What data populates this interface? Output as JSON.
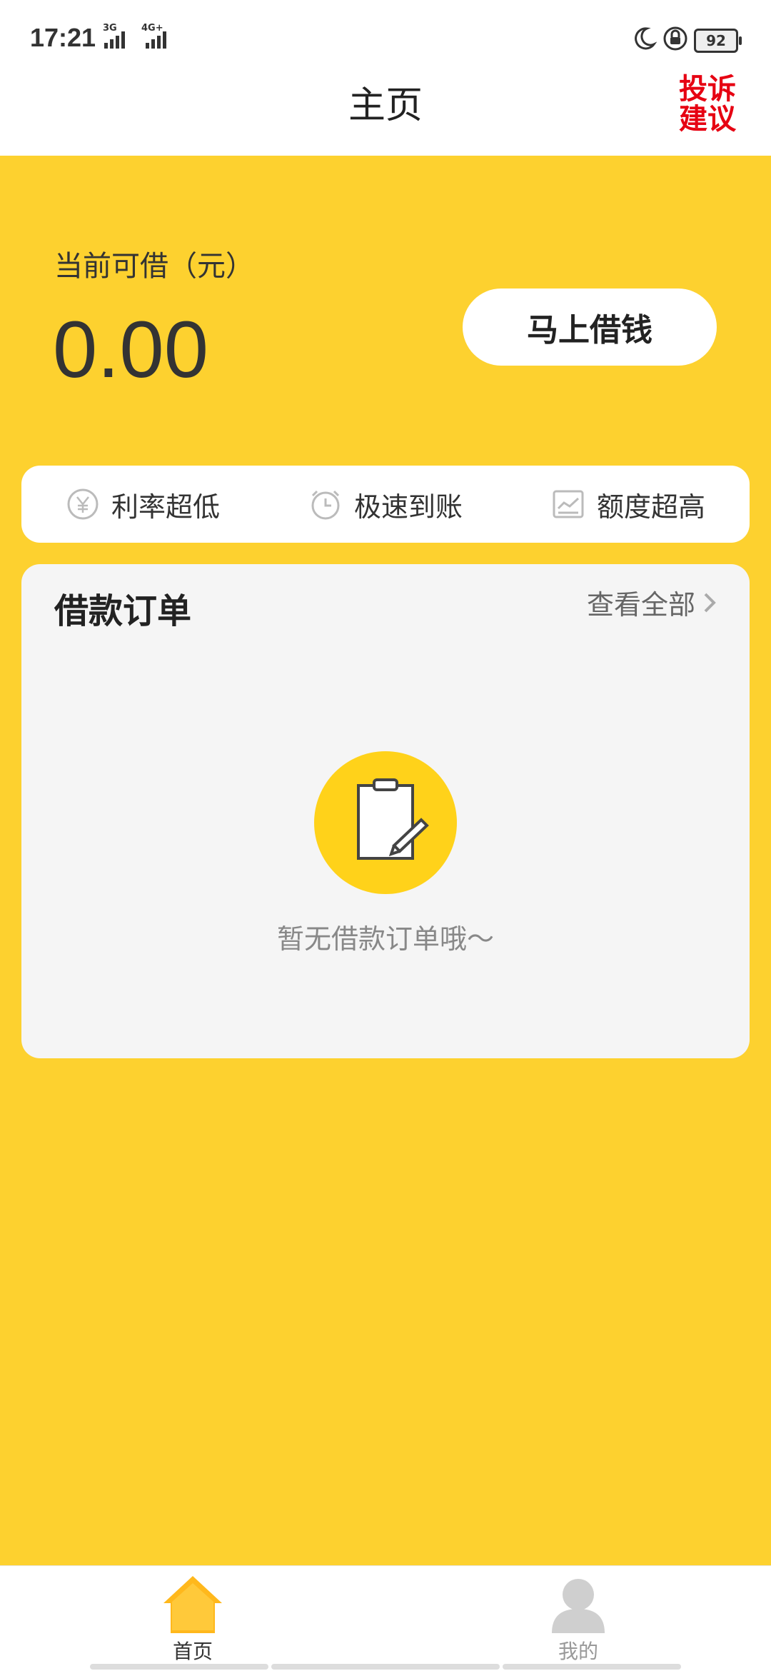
{
  "status_bar": {
    "time": "17:21",
    "signal1_label": "3G",
    "signal2_label": "4G+",
    "battery": "92"
  },
  "header": {
    "title": "主页",
    "complaint_line1": "投诉",
    "complaint_line2": "建议"
  },
  "loan": {
    "limit_label": "当前可借（元）",
    "limit_value": "0.00",
    "borrow_button": "马上借钱"
  },
  "features": [
    {
      "label": "利率超低",
      "icon": "yen-icon"
    },
    {
      "label": "极速到账",
      "icon": "clock-icon"
    },
    {
      "label": "额度超高",
      "icon": "chart-icon"
    }
  ],
  "orders": {
    "title": "借款订单",
    "view_all": "查看全部",
    "empty_text": "暂无借款订单哦～"
  },
  "tabs": [
    {
      "label": "首页",
      "icon": "home-icon",
      "active": true
    },
    {
      "label": "我的",
      "icon": "user-icon",
      "active": false
    }
  ],
  "colors": {
    "background": "#FDD12F",
    "accent_red": "#E60012",
    "icon_yellow": "#FFD21A"
  }
}
